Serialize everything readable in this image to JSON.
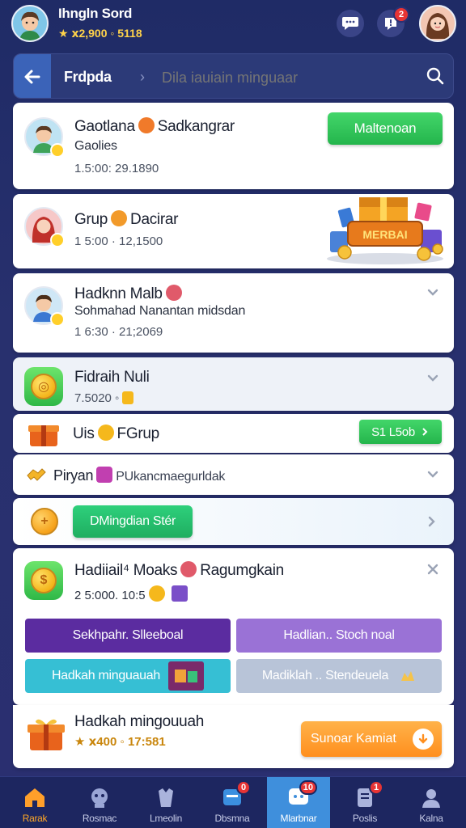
{
  "user": {
    "name": "Ihngln Sord",
    "stats": "★ ⅹ2,900 ◦ 5118"
  },
  "search": {
    "title": "Frdpda",
    "placeholder": "Dila iauiain minguaar"
  },
  "cards": {
    "c1": {
      "title": "Gaotlana",
      "title2": "Sadkangrar",
      "sub": "Gaolies",
      "meta": "1.5:00: 29.1890",
      "button": "Maltenoan"
    },
    "c2": {
      "title": "Grup",
      "title2": "Dacirar",
      "meta": "1 5:00 · 12,1500",
      "promo": "MERBAI"
    },
    "c3": {
      "title": "Hadknn Malb",
      "sub": "Sohmahad Nanantan midsdan",
      "meta": "1 6:30 · 21;2069"
    },
    "c4": {
      "title": "Fidraih Nuli",
      "meta": "7.5020 ◦"
    },
    "c5": {
      "title": "Uis",
      "title2": "FGrup",
      "button": "S1 L5ob"
    },
    "c6": {
      "title": "Piryan",
      "sub": "PUkancmaegurldak"
    },
    "c7": {
      "button": "DMingdian Stér"
    },
    "c8": {
      "title": "Hadiiail⁴ Moaks",
      "title2": "Ragumgkain",
      "meta": "2 5:000. 10:5",
      "pill1": "Sekhpahr. Slleeboal",
      "pill2": "Hadlian.. Stoch noal",
      "pill3": "Hadkah minguauah",
      "pill4": "Madiklah .. Stendeuela"
    },
    "c9": {
      "title": "Hadkah mingouuah",
      "meta": "★ ⅹ400 ◦ 17:581",
      "button": "Sunoar Kamiat"
    }
  },
  "nav": {
    "n1": "Rarak",
    "n2": "Rosmac",
    "n3": "Lmeolin",
    "n4": "Dbsmna",
    "n5": "Mlarbnar",
    "n6": "Poslis",
    "n7": "Kalna",
    "badge_alert": "2",
    "badge_n4": "0",
    "badge_n5": "10",
    "badge_n6": "1"
  },
  "colors": {
    "bg": "#28306e",
    "accent_green": "#2fbf55",
    "accent_purple": "#5b2ca0",
    "accent_lilac": "#9a72d6",
    "accent_teal": "#36bfd4",
    "accent_orange": "#ff9a2e",
    "active_nav": "#3f8fdc"
  },
  "icons": [
    "back-arrow-icon",
    "search-icon",
    "chat-icon",
    "bell-icon",
    "chevron-down-icon",
    "chevron-right-icon",
    "close-icon",
    "gift-icon",
    "coin-icon",
    "home-icon"
  ]
}
